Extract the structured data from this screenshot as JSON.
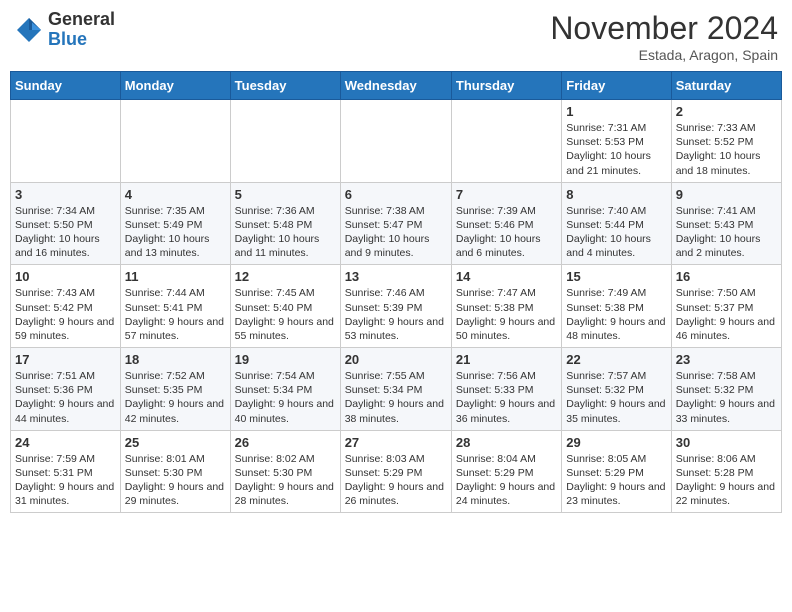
{
  "header": {
    "logo_general": "General",
    "logo_blue": "Blue",
    "month_title": "November 2024",
    "location": "Estada, Aragon, Spain"
  },
  "weekdays": [
    "Sunday",
    "Monday",
    "Tuesday",
    "Wednesday",
    "Thursday",
    "Friday",
    "Saturday"
  ],
  "weeks": [
    [
      {
        "day": "",
        "info": ""
      },
      {
        "day": "",
        "info": ""
      },
      {
        "day": "",
        "info": ""
      },
      {
        "day": "",
        "info": ""
      },
      {
        "day": "",
        "info": ""
      },
      {
        "day": "1",
        "info": "Sunrise: 7:31 AM\nSunset: 5:53 PM\nDaylight: 10 hours and 21 minutes."
      },
      {
        "day": "2",
        "info": "Sunrise: 7:33 AM\nSunset: 5:52 PM\nDaylight: 10 hours and 18 minutes."
      }
    ],
    [
      {
        "day": "3",
        "info": "Sunrise: 7:34 AM\nSunset: 5:50 PM\nDaylight: 10 hours and 16 minutes."
      },
      {
        "day": "4",
        "info": "Sunrise: 7:35 AM\nSunset: 5:49 PM\nDaylight: 10 hours and 13 minutes."
      },
      {
        "day": "5",
        "info": "Sunrise: 7:36 AM\nSunset: 5:48 PM\nDaylight: 10 hours and 11 minutes."
      },
      {
        "day": "6",
        "info": "Sunrise: 7:38 AM\nSunset: 5:47 PM\nDaylight: 10 hours and 9 minutes."
      },
      {
        "day": "7",
        "info": "Sunrise: 7:39 AM\nSunset: 5:46 PM\nDaylight: 10 hours and 6 minutes."
      },
      {
        "day": "8",
        "info": "Sunrise: 7:40 AM\nSunset: 5:44 PM\nDaylight: 10 hours and 4 minutes."
      },
      {
        "day": "9",
        "info": "Sunrise: 7:41 AM\nSunset: 5:43 PM\nDaylight: 10 hours and 2 minutes."
      }
    ],
    [
      {
        "day": "10",
        "info": "Sunrise: 7:43 AM\nSunset: 5:42 PM\nDaylight: 9 hours and 59 minutes."
      },
      {
        "day": "11",
        "info": "Sunrise: 7:44 AM\nSunset: 5:41 PM\nDaylight: 9 hours and 57 minutes."
      },
      {
        "day": "12",
        "info": "Sunrise: 7:45 AM\nSunset: 5:40 PM\nDaylight: 9 hours and 55 minutes."
      },
      {
        "day": "13",
        "info": "Sunrise: 7:46 AM\nSunset: 5:39 PM\nDaylight: 9 hours and 53 minutes."
      },
      {
        "day": "14",
        "info": "Sunrise: 7:47 AM\nSunset: 5:38 PM\nDaylight: 9 hours and 50 minutes."
      },
      {
        "day": "15",
        "info": "Sunrise: 7:49 AM\nSunset: 5:38 PM\nDaylight: 9 hours and 48 minutes."
      },
      {
        "day": "16",
        "info": "Sunrise: 7:50 AM\nSunset: 5:37 PM\nDaylight: 9 hours and 46 minutes."
      }
    ],
    [
      {
        "day": "17",
        "info": "Sunrise: 7:51 AM\nSunset: 5:36 PM\nDaylight: 9 hours and 44 minutes."
      },
      {
        "day": "18",
        "info": "Sunrise: 7:52 AM\nSunset: 5:35 PM\nDaylight: 9 hours and 42 minutes."
      },
      {
        "day": "19",
        "info": "Sunrise: 7:54 AM\nSunset: 5:34 PM\nDaylight: 9 hours and 40 minutes."
      },
      {
        "day": "20",
        "info": "Sunrise: 7:55 AM\nSunset: 5:34 PM\nDaylight: 9 hours and 38 minutes."
      },
      {
        "day": "21",
        "info": "Sunrise: 7:56 AM\nSunset: 5:33 PM\nDaylight: 9 hours and 36 minutes."
      },
      {
        "day": "22",
        "info": "Sunrise: 7:57 AM\nSunset: 5:32 PM\nDaylight: 9 hours and 35 minutes."
      },
      {
        "day": "23",
        "info": "Sunrise: 7:58 AM\nSunset: 5:32 PM\nDaylight: 9 hours and 33 minutes."
      }
    ],
    [
      {
        "day": "24",
        "info": "Sunrise: 7:59 AM\nSunset: 5:31 PM\nDaylight: 9 hours and 31 minutes."
      },
      {
        "day": "25",
        "info": "Sunrise: 8:01 AM\nSunset: 5:30 PM\nDaylight: 9 hours and 29 minutes."
      },
      {
        "day": "26",
        "info": "Sunrise: 8:02 AM\nSunset: 5:30 PM\nDaylight: 9 hours and 28 minutes."
      },
      {
        "day": "27",
        "info": "Sunrise: 8:03 AM\nSunset: 5:29 PM\nDaylight: 9 hours and 26 minutes."
      },
      {
        "day": "28",
        "info": "Sunrise: 8:04 AM\nSunset: 5:29 PM\nDaylight: 9 hours and 24 minutes."
      },
      {
        "day": "29",
        "info": "Sunrise: 8:05 AM\nSunset: 5:29 PM\nDaylight: 9 hours and 23 minutes."
      },
      {
        "day": "30",
        "info": "Sunrise: 8:06 AM\nSunset: 5:28 PM\nDaylight: 9 hours and 22 minutes."
      }
    ]
  ]
}
